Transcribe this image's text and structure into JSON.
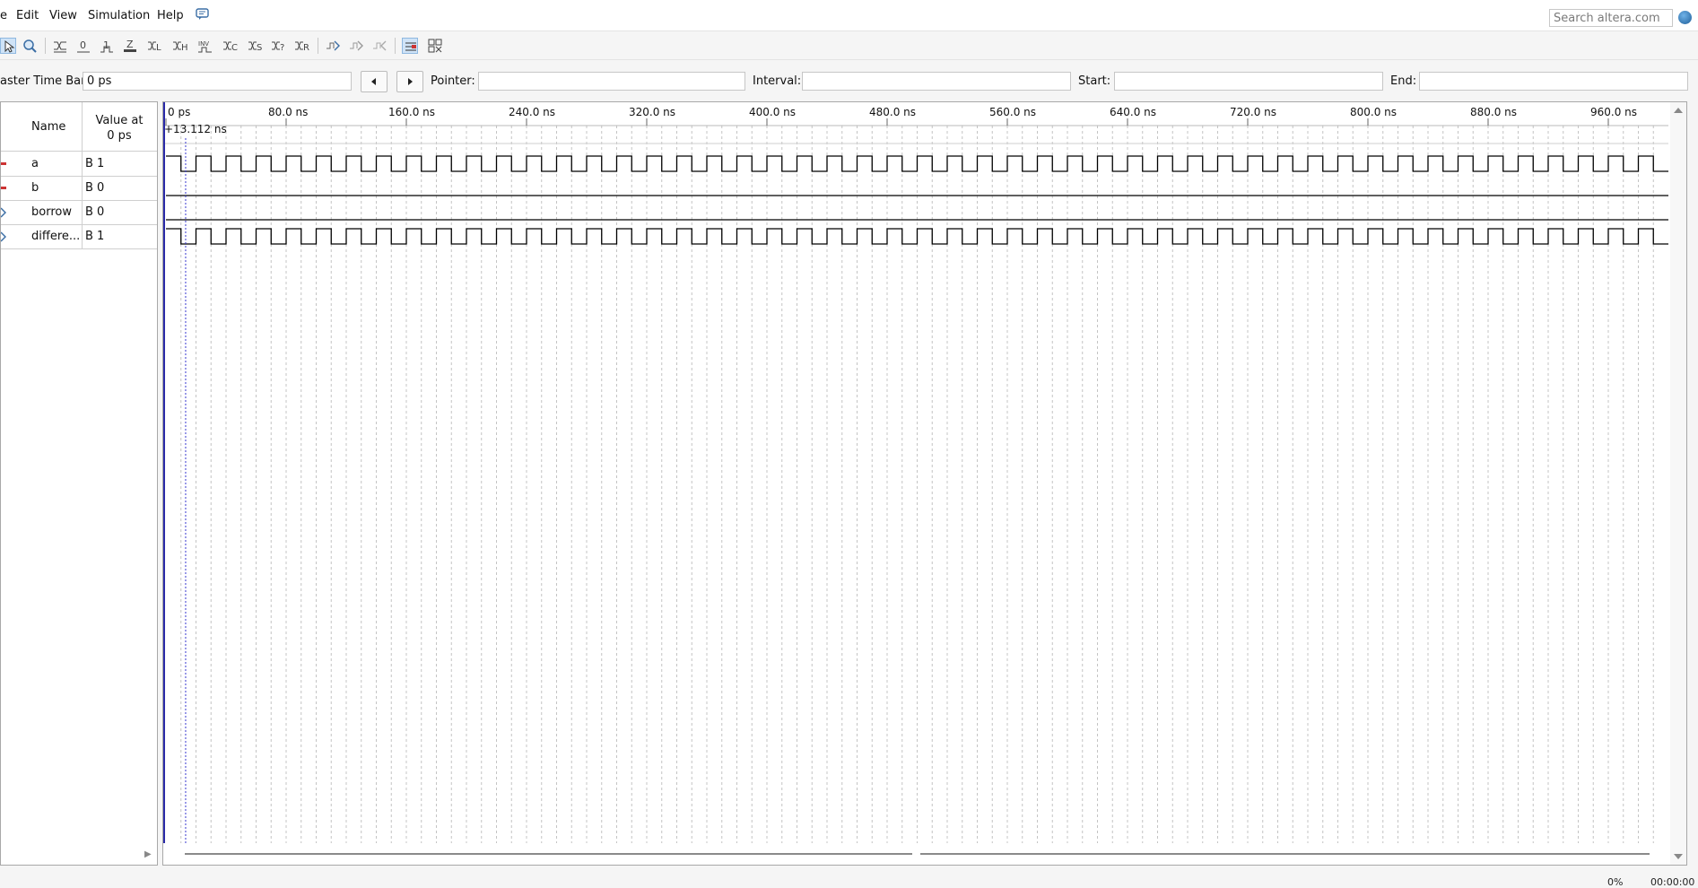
{
  "menu": {
    "items": [
      "e",
      "Edit",
      "View",
      "Simulation",
      "Help"
    ],
    "search_placeholder": "Search altera.com"
  },
  "toolbar": {
    "icons": [
      "selection-tool-icon",
      "zoom-tool-icon",
      "forcing-unknown-icon",
      "forcing-low-icon",
      "forcing-high-icon",
      "forcing-high-impedance-icon",
      "invert-icon",
      "count-value-icon",
      "forcing-weak-low-icon",
      "forcing-weak-high-icon",
      "overwrite-clock-icon",
      "random-values-icon",
      "forcing-dont-care-icon",
      "arbitrary-value-icon",
      "snap-to-grid-icon",
      "grid-settings-icon",
      "find-transition-icon",
      "simulation-run-icon",
      "group-bus-icon"
    ]
  },
  "timebar": {
    "master_label": "aster Time Bar:",
    "master_value": "0 ps",
    "pointer_label": "Pointer:",
    "pointer_value": "",
    "interval_label": "Interval:",
    "interval_value": "",
    "start_label": "Start:",
    "start_value": "",
    "end_label": "End:",
    "end_value": ""
  },
  "signal_table": {
    "col_name": "Name",
    "col_value_line1": "Value at",
    "col_value_line2": "0 ps",
    "signals": [
      {
        "name": "a",
        "value": "B 1"
      },
      {
        "name": "b",
        "value": "B 0"
      },
      {
        "name": "borrow",
        "value": "B 0"
      },
      {
        "name": "differe...",
        "value": "B 1"
      }
    ]
  },
  "waveform": {
    "time_marks": [
      "0 ps",
      "80.0 ns",
      "160.0 ns",
      "240.0 ns",
      "320.0 ns",
      "400.0 ns",
      "480.0 ns",
      "560.0 ns",
      "640.0 ns",
      "720.0 ns",
      "800.0 ns",
      "880.0 ns",
      "960.0 ns"
    ],
    "cursor_label": "+13.112 ns",
    "clock_period_ns": 20,
    "b_level": 0,
    "borrow_level": 0
  },
  "status": {
    "progress": "0%",
    "elapsed": "00:00:00"
  }
}
